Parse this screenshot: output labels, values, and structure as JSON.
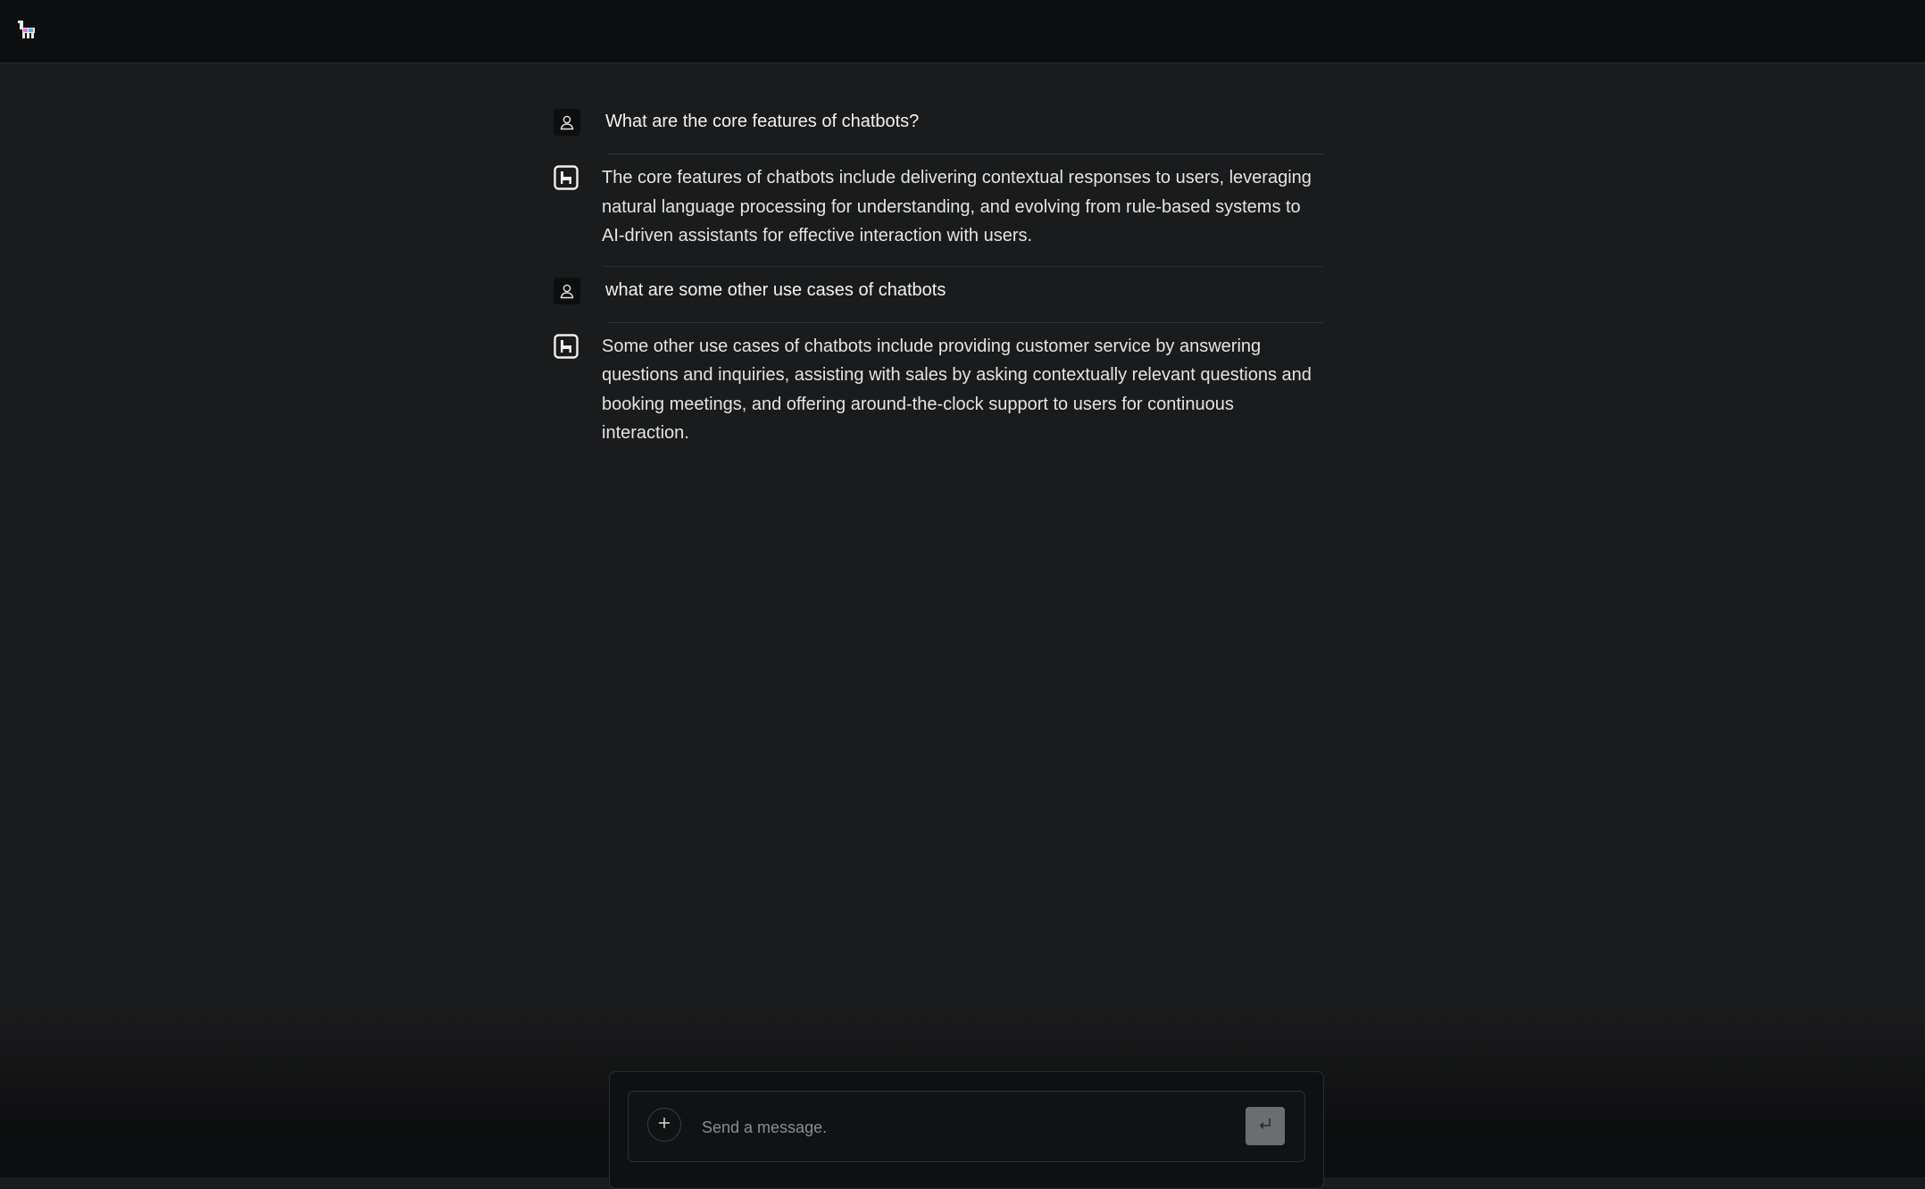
{
  "app": {
    "logo_icon": "llama-icon"
  },
  "conversation": [
    {
      "role": "user",
      "avatar_icon": "user-icon",
      "text": "What are the core features of chatbots?"
    },
    {
      "role": "assistant",
      "avatar_icon": "llama-icon",
      "text": "The core features of chatbots include delivering contextual responses to users, leveraging natural language processing for understanding, and evolving from rule-based systems to AI-driven assistants for effective interaction with users."
    },
    {
      "role": "user",
      "avatar_icon": "user-icon",
      "text": "what are some other use cases of chatbots"
    },
    {
      "role": "assistant",
      "avatar_icon": "llama-icon",
      "text": "Some other use cases of chatbots include providing customer service by answering questions and inquiries, assisting with sales by asking contextually relevant questions and booking meetings, and offering around-the-clock support to users for continuous interaction."
    }
  ],
  "composer": {
    "placeholder": "Send a message.",
    "value": "",
    "attach_icon": "plus-icon",
    "send_icon": "enter-icon"
  },
  "colors": {
    "background": "#1a1b1c",
    "topbar": "#0e0f10",
    "send_button": "#6b6d70"
  }
}
